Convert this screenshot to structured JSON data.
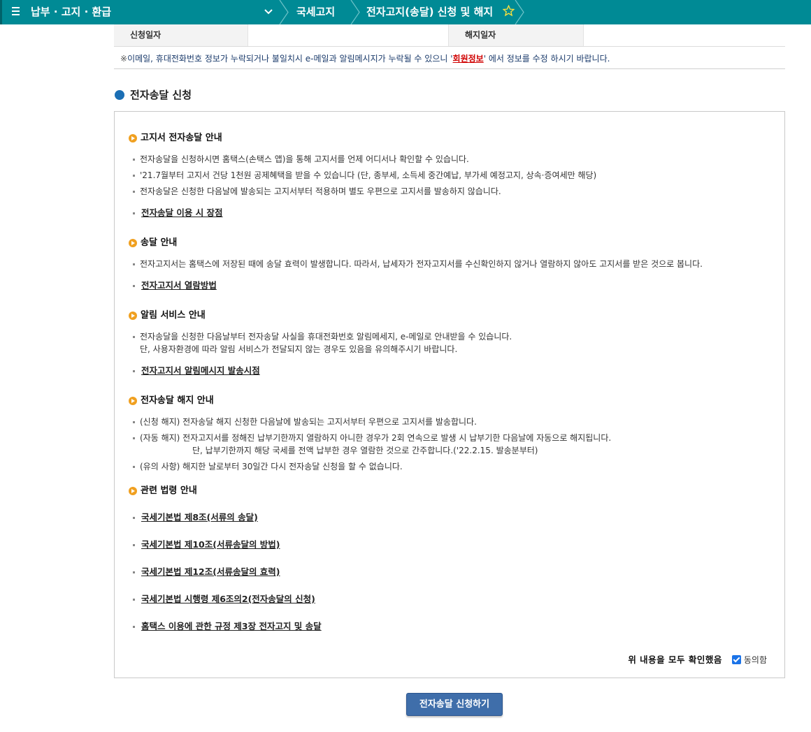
{
  "topbar": {
    "menu_label": "납부 · 고지 · 환급",
    "crumb1": "국세고지",
    "crumb2": "전자고지(송달) 신청 및 해지"
  },
  "dates": {
    "apply_label": "신청일자",
    "apply_value": "",
    "cancel_label": "해지일자",
    "cancel_value": ""
  },
  "notice": {
    "mark": "※",
    "before": "이메일, 휴대전화번호 정보가 누락되거나 불일치시 e-메일과 알림메시지가 누락될 수 있으니 '",
    "link": "회원정보",
    "after": "' 에서 정보를 수정 하시기 바랍니다."
  },
  "section_title": "전자송달 신청",
  "box": {
    "s1": {
      "title": "고지서 전자송달 안내",
      "items": [
        "전자송달을 신청하시면 홈택스(손택스 앱)을 통해 고지서를 언제 어디서나 확인할 수 있습니다.",
        "'21.7월부터 고지서 건당 1천원 공제혜택을 받을 수 있습니다 (단, 종부세, 소득세 중간예납, 부가세 예정고지, 상속·증여세만 해당)",
        "전자송달은 신청한 다음날에 발송되는 고지서부터 적용하며 별도 우편으로 고지서를 발송하지 않습니다."
      ],
      "link": "전자송달 이용 시 장점"
    },
    "s2": {
      "title": "송달 안내",
      "items": [
        "전자고지서는 홈택스에 저장된 때에 송달 효력이 발생합니다. 따라서, 납세자가 전자고지서를 수신확인하지 않거나 열람하지 않아도 고지서를 받은 것으로 봅니다."
      ],
      "link": "전자고지서 열람방법"
    },
    "s3": {
      "title": "알림 서비스 안내",
      "items": [
        "전자송달을 신청한 다음날부터 전자송달 사실을 휴대전화번호 알림메세지, e-메일로 안내받을 수 있습니다.",
        "단, 사용자환경에 따라 알림 서비스가 전달되지 않는 경우도 있음을 유의해주시기 바랍니다."
      ],
      "link": "전자고지서 알림메시지 발송시점"
    },
    "s4": {
      "title": "전자송달 해지 안내",
      "items": [
        "(신청 해지) 전자송달 해지 신청한 다음날에 발송되는 고지서부터 우편으로 고지서를 발송합니다.",
        "(자동 해지) 전자고지서를 정해진 납부기한까지 열람하지 아니한 경우가 2회 연속으로 발생 시 납부기한 다음날에 자동으로 해지됩니다.",
        "단, 납부기한까지 해당 국세를 전액 납부한 경우 열람한 것으로 간주합니다.('22.2.15. 발송분부터)",
        "(유의 사항) 해지한 날로부터 30일간 다시 전자송달 신청을 할 수 없습니다."
      ]
    },
    "s5": {
      "title": "관련 법령 안내",
      "links": [
        "국세기본법 제8조(서류의 송달)",
        "국세기본법 제10조(서류송달의 방법)",
        "국세기본법 제12조(서류송달의 효력)",
        "국세기본법 시행령 제6조의2(전자송달의 신청)",
        "홈택스 이용에 관한 규정 제3장 전자고지 및 송달"
      ]
    },
    "confirm_text": "위 내용을 모두 확인했음",
    "agree_label": "동의함",
    "agree_checked": true
  },
  "submit_label": "전자송달 신청하기",
  "colors": {
    "topbar": "#008a95",
    "button": "#3f6eaa",
    "link_red": "#d00000",
    "bullet_orange": "#f0a020"
  }
}
